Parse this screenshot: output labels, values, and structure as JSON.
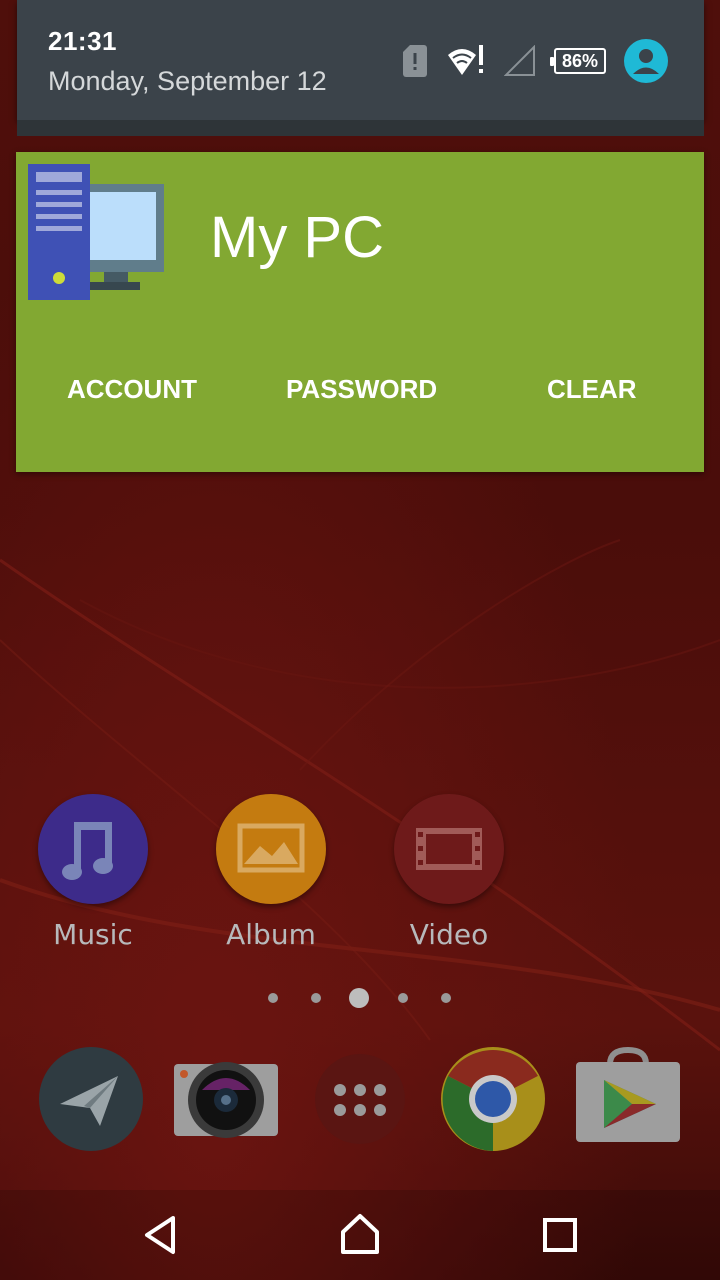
{
  "status_bar": {
    "time": "21:31",
    "date": "Monday, September 12",
    "battery_percent": "86%",
    "icons": [
      "sim-alert-icon",
      "wifi-alert-icon",
      "cell-signal-icon",
      "battery-icon",
      "account-icon"
    ]
  },
  "widget": {
    "title": "My PC",
    "icon": "computer-icon",
    "background": "#82a832",
    "buttons": {
      "account": "ACCOUNT",
      "password": "PASSWORD",
      "clear": "CLEAR"
    }
  },
  "apps": {
    "music": {
      "label": "Music",
      "icon": "music-note-icon",
      "color": "#3d2b8a"
    },
    "album": {
      "label": "Album",
      "icon": "picture-icon",
      "color": "#c47b10"
    },
    "video": {
      "label": "Video",
      "icon": "film-icon",
      "color": "#6e1a1a"
    }
  },
  "page_indicator": {
    "count": 5,
    "active_index": 2
  },
  "dock": [
    "paper-plane-icon",
    "camera-icon",
    "app-drawer-icon",
    "chrome-icon",
    "play-store-icon"
  ],
  "nav_bar": [
    "back-icon",
    "home-icon",
    "recents-icon"
  ]
}
